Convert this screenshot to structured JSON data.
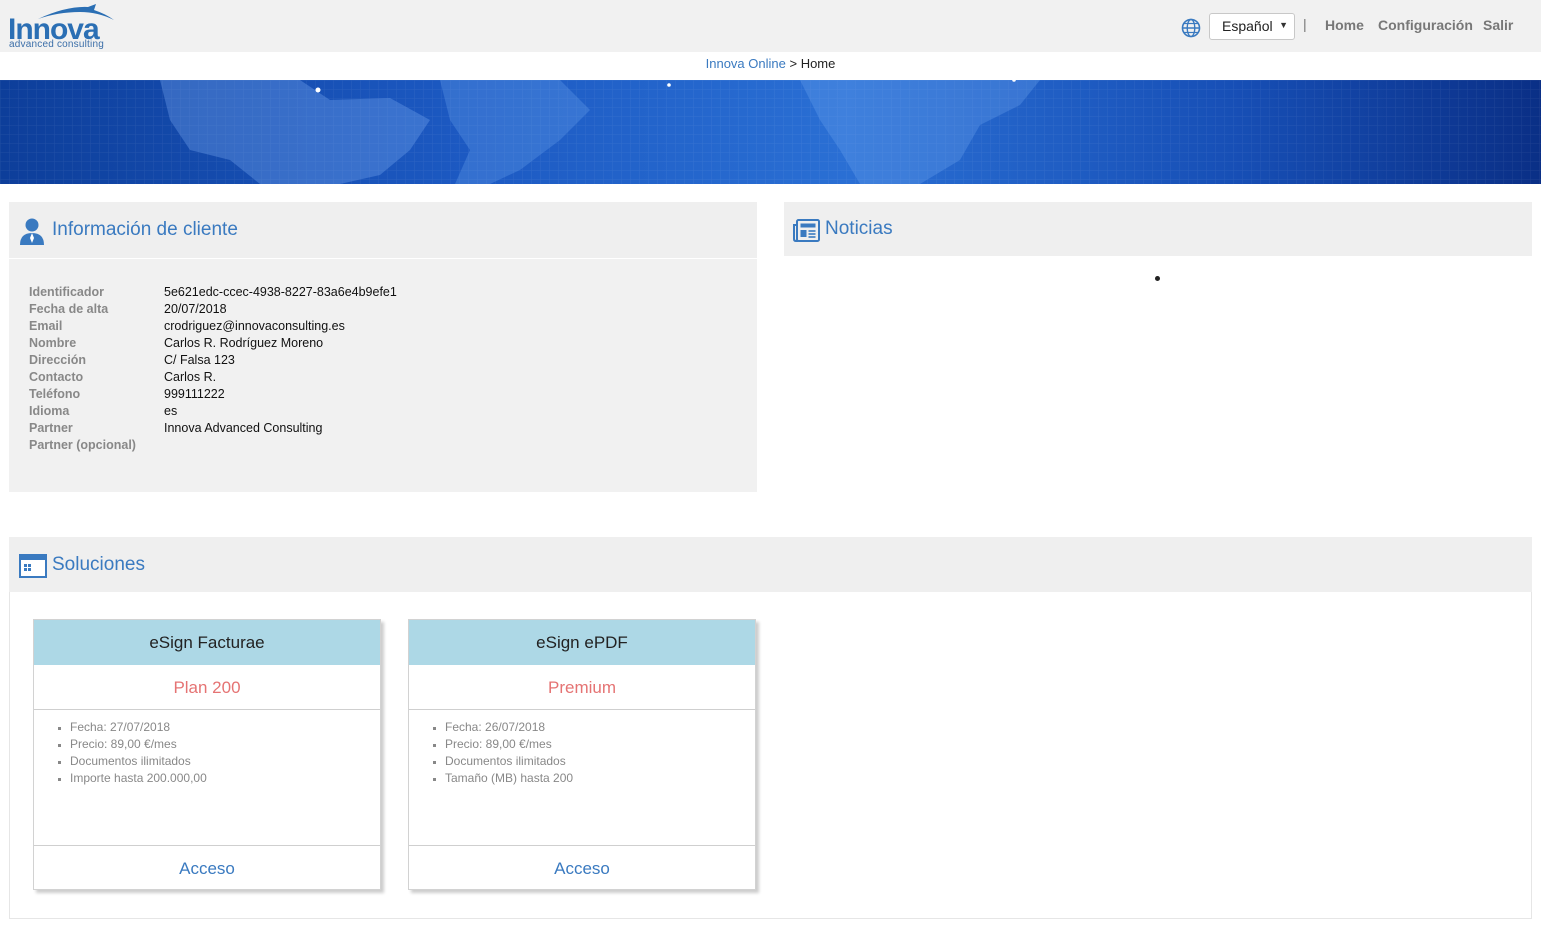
{
  "header": {
    "logo_text": "Innova",
    "logo_subtext": "advanced consulting",
    "language_selected": "Español",
    "separator": "|",
    "nav": [
      {
        "label": "Home"
      },
      {
        "label": "Configuración"
      },
      {
        "label": "Salir"
      }
    ]
  },
  "breadcrumb": {
    "root": "Innova Online",
    "sep": " > ",
    "current": "Home"
  },
  "client_info": {
    "title": "Información de cliente",
    "rows": [
      {
        "label": "Identificador",
        "value": "5e621edc-ccec-4938-8227-83a6e4b9efe1"
      },
      {
        "label": "Fecha de alta",
        "value": "20/07/2018"
      },
      {
        "label": "Email",
        "value": "crodriguez@innovaconsulting.es"
      },
      {
        "label": "Nombre",
        "value": "Carlos R. Rodríguez Moreno"
      },
      {
        "label": "Dirección",
        "value": "C/ Falsa 123"
      },
      {
        "label": "Contacto",
        "value": "Carlos R."
      },
      {
        "label": "Teléfono",
        "value": "999111222"
      },
      {
        "label": "Idioma",
        "value": "es"
      },
      {
        "label": "Partner",
        "value": "Innova Advanced Consulting"
      },
      {
        "label": "Partner (opcional)",
        "value": ""
      }
    ]
  },
  "news": {
    "title": "Noticias"
  },
  "solutions": {
    "title": "Soluciones",
    "cards": [
      {
        "name": "eSign Facturae",
        "plan": "Plan 200",
        "features": [
          "Fecha: 27/07/2018",
          "Precio: 89,00 €/mes",
          "Documentos ilimitados",
          "Importe hasta 200.000,00"
        ],
        "access_label": "Acceso"
      },
      {
        "name": "eSign ePDF",
        "plan": "Premium",
        "features": [
          "Fecha: 26/07/2018",
          "Precio: 89,00 €/mes",
          "Documentos ilimitados",
          "Tamaño (MB) hasta 200"
        ],
        "access_label": "Acceso"
      }
    ]
  },
  "icons": {
    "globe": "globe-icon",
    "user": "user-icon",
    "news": "newspaper-icon",
    "solutions": "window-grid-icon"
  },
  "colors": {
    "accent": "#3a7ac0",
    "plan": "#e57373",
    "card_header": "#add8e6",
    "panel": "#efefef"
  }
}
